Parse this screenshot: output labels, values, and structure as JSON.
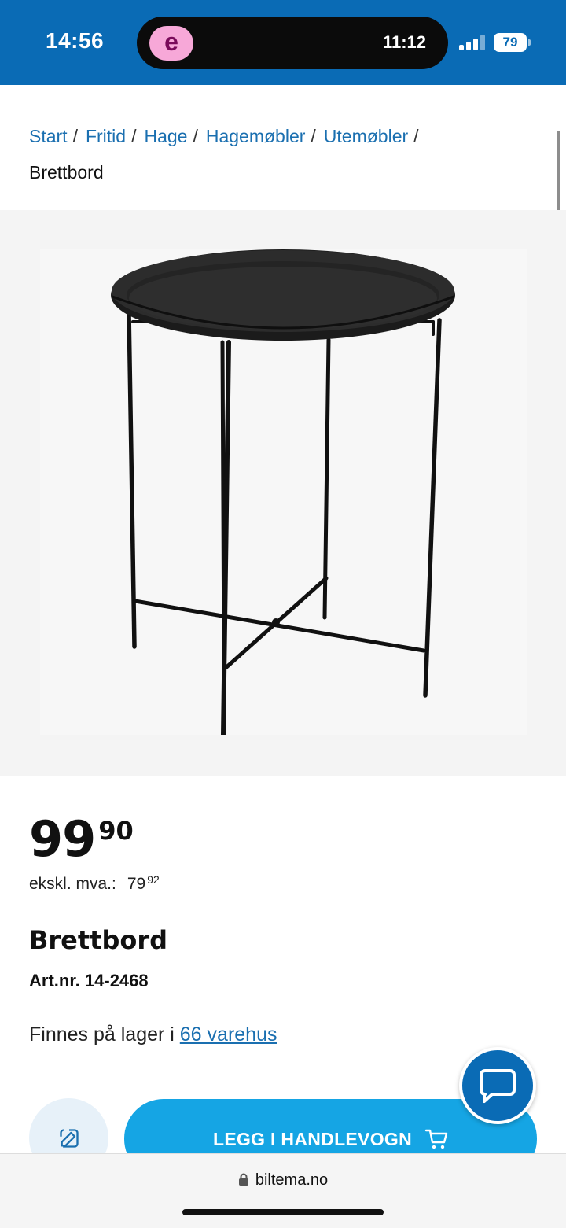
{
  "status_bar": {
    "time": "14:56",
    "island_app_letter": "e",
    "island_time": "11:12",
    "battery": "79"
  },
  "breadcrumb": {
    "items": [
      "Start",
      "Fritid",
      "Hage",
      "Hagemøbler",
      "Utemøbler"
    ],
    "separator": "/",
    "current": "Brettbord"
  },
  "product": {
    "price_main": "99",
    "price_decimals": "90",
    "excl_label": "ekskl. mva.:",
    "excl_main": "79",
    "excl_decimals": "92",
    "name": "Brettbord",
    "art_nr": "Art.nr. 14-2468",
    "stock_prefix": "Finnes på lager i ",
    "stock_link": "66 varehus"
  },
  "actions": {
    "add_to_cart": "LEGG I HANDLEVOGN",
    "edit_icon": "edit-icon",
    "chat_icon": "chat-bubble-icon",
    "cart_icon": "cart-icon"
  },
  "browser": {
    "url": "biltema.no"
  },
  "colors": {
    "brand_blue": "#0a6bb5",
    "cart_button": "#15a5e4",
    "link": "#1a6fb0"
  }
}
